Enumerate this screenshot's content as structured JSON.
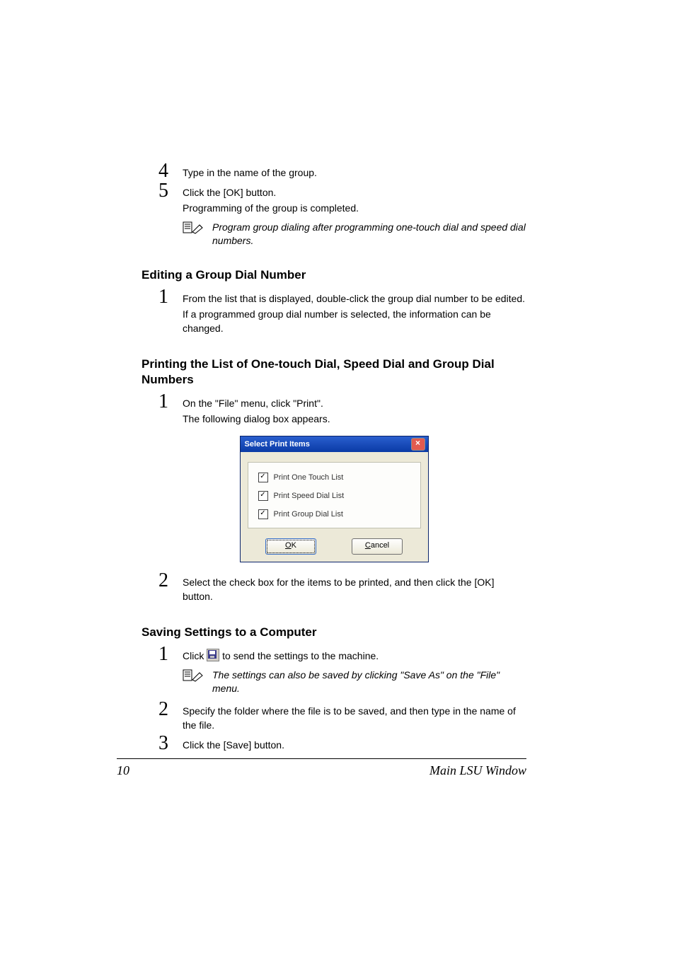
{
  "steps_before": [
    {
      "num": "4",
      "text": "Type in the name of the group."
    },
    {
      "num": "5",
      "text": "Click the [OK] button.",
      "text2": "Programming of the group is completed."
    }
  ],
  "notes": [
    {
      "text": "Program group dialing after programming one-touch dial and speed dial numbers."
    },
    {
      "text": "The settings can also be saved by clicking \"Save As\" on the \"File\" menu."
    }
  ],
  "sections": {
    "editing": {
      "heading": "Editing a Group Dial Number",
      "steps": [
        {
          "num": "1",
          "text": "From the list that is displayed, double-click the group dial number to be edited.",
          "text2": "If a programmed group dial number is selected, the information can be changed."
        }
      ]
    },
    "printing": {
      "heading": "Printing the List of One-touch Dial, Speed Dial and Group Dial Numbers",
      "steps": [
        {
          "num": "1",
          "text": "On the \"File\" menu, click \"Print\".",
          "text2": "The following dialog box appears."
        },
        {
          "num": "2",
          "text": "Select the check box for the items to be printed, and then click the [OK] button."
        }
      ]
    },
    "saving": {
      "heading": "Saving Settings to a Computer",
      "steps": [
        {
          "num": "1",
          "text_before": "Click ",
          "text_after": " to send the settings to the machine."
        },
        {
          "num": "2",
          "text": "Specify the folder where the file is to be saved, and then type in the name of the file."
        },
        {
          "num": "3",
          "text": "Click the [Save] button."
        }
      ]
    }
  },
  "dialog": {
    "title": "Select Print Items",
    "options": [
      "Print One Touch List",
      "Print Speed Dial List",
      "Print Group Dial List"
    ],
    "ok_label": "OK",
    "cancel_label": "Cancel"
  },
  "footer": {
    "page_number": "10",
    "title": "Main LSU Window"
  }
}
